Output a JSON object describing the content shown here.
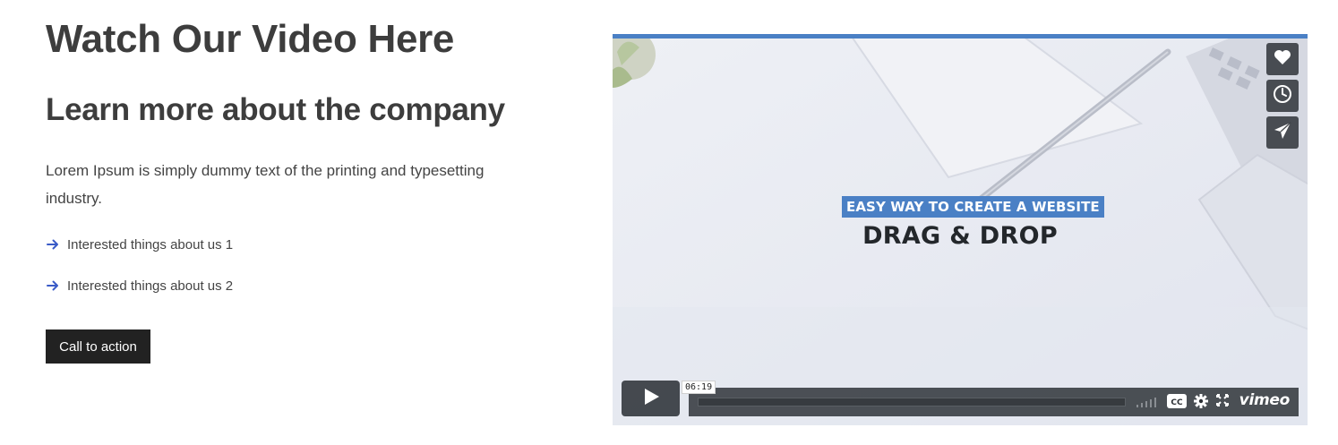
{
  "section": {
    "title": "Watch Our Video Here",
    "subtitle": "Learn more about the company",
    "description": "Lorem Ipsum is simply dummy text of the printing and typesetting industry.",
    "list": [
      {
        "label": "Interested things about us 1",
        "icon": "arrow-right-icon"
      },
      {
        "label": "Interested things about us 2",
        "icon": "arrow-right-icon"
      }
    ],
    "cta_label": "Call to action"
  },
  "video": {
    "headline_tag": "EASY WAY TO CREATE A WEBSITE",
    "headline_main": "DRAG & DROP",
    "duration": "06:19",
    "progress": 0,
    "side_buttons": [
      "heart-icon",
      "clock-icon",
      "send-icon"
    ],
    "controls": [
      "volume-icon",
      "cc-icon",
      "settings-icon",
      "fullscreen-icon"
    ],
    "brand": "vimeo",
    "accent_color": "#4a80c5"
  },
  "colors": {
    "text": "#3d3d3d",
    "cta_bg": "#222222",
    "arrow": "#3a5bc7"
  }
}
